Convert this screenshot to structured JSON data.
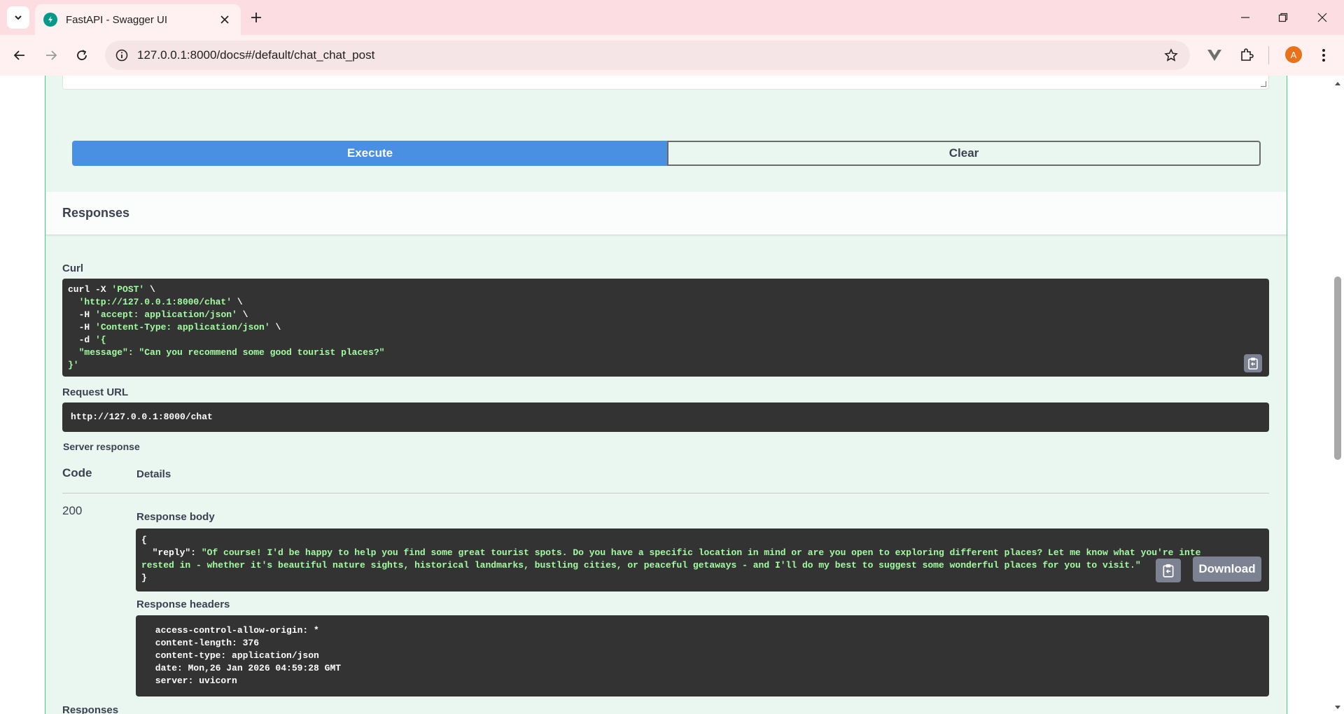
{
  "browser": {
    "tab_title": "FastAPI - Swagger UI",
    "url": "127.0.0.1:8000/docs#/default/chat_chat_post",
    "profile_initial": "A"
  },
  "operation": {
    "execute_label": "Execute",
    "clear_label": "Clear",
    "responses_title": "Responses",
    "curl_label": "Curl",
    "curl_lines": [
      "curl -X ",
      "'POST'",
      " \\",
      "  'http://127.0.0.1:8000/chat'",
      " \\",
      "  -H ",
      "'accept: application/json'",
      " \\",
      "  -H ",
      "'Content-Type: application/json'",
      " \\",
      "  -d ",
      "'{",
      "  \"message\": \"Can you recommend some good tourist places?\"",
      "}'"
    ],
    "request_url_label": "Request URL",
    "request_url": "http://127.0.0.1:8000/chat",
    "server_response_label": "Server response",
    "code_header": "Code",
    "details_header": "Details",
    "status_code": "200",
    "response_body_label": "Response body",
    "response_body": {
      "open": "{",
      "key": "  \"reply\": ",
      "line1": "\"Of course! I'd be happy to help you find some great tourist spots. Do you have a specific location in mind or are you open to exploring different places? Let me know what you're inte",
      "line2": "rested in - whether it's beautiful nature sights, historical landmarks, bustling cities, or peaceful getaways - and I'll do my best to suggest some wonderful places for you to visit.\"",
      "close": "}"
    },
    "download_label": "Download",
    "response_headers_label": "Response headers",
    "response_headers": [
      " access-control-allow-origin: * ",
      " content-length: 376 ",
      " content-type: application/json ",
      " date: Mon,26 Jan 2026 04:59:28 GMT ",
      " server: uvicorn "
    ],
    "next_responses_label": "Responses"
  }
}
